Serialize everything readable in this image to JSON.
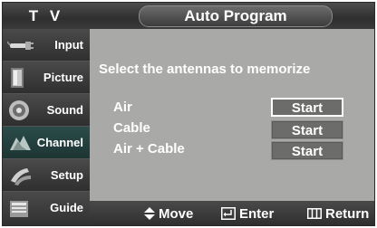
{
  "header": {
    "tv_label": "T V",
    "title": "Auto Program"
  },
  "sidebar": {
    "items": [
      {
        "label": "Input",
        "icon": "input-icon"
      },
      {
        "label": "Picture",
        "icon": "picture-icon"
      },
      {
        "label": "Sound",
        "icon": "sound-icon"
      },
      {
        "label": "Channel",
        "icon": "channel-icon",
        "active": true
      },
      {
        "label": "Setup",
        "icon": "setup-icon"
      },
      {
        "label": "Guide",
        "icon": "guide-icon"
      }
    ]
  },
  "main": {
    "instruction": "Select the antennas to memorize",
    "options": [
      {
        "label": "Air",
        "button": "Start",
        "focused": true
      },
      {
        "label": "Cable",
        "button": "Start",
        "focused": false
      },
      {
        "label": "Air + Cable",
        "button": "Start",
        "focused": false
      }
    ]
  },
  "footer": {
    "move": "Move",
    "enter": "Enter",
    "return": "Return"
  },
  "colors": {
    "panel_bg": "#a9aaa8",
    "sidebar_bg": "#3b3b3b",
    "active_item_bg": "#2a4c4a",
    "button_bg": "#6c6d6b"
  }
}
